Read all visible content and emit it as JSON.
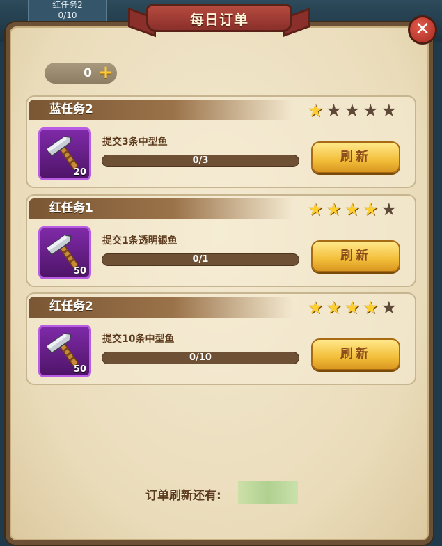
{
  "background_tab": {
    "title": "红任务2",
    "progress": "0/10"
  },
  "header": {
    "title": "每日订单"
  },
  "currency": {
    "value": "0",
    "plus_label": "+"
  },
  "tasks": [
    {
      "name": "蓝任务2",
      "stars": 1,
      "max_stars": 5,
      "item_count": "20",
      "description": "提交3条中型鱼",
      "progress_text": "0/3",
      "progress_fraction": 0,
      "button_label": "刷新"
    },
    {
      "name": "红任务1",
      "stars": 4,
      "max_stars": 5,
      "item_count": "50",
      "description": "提交1条透明银鱼",
      "progress_text": "0/1",
      "progress_fraction": 0,
      "button_label": "刷新"
    },
    {
      "name": "红任务2",
      "stars": 4,
      "max_stars": 5,
      "item_count": "50",
      "description": "提交10条中型鱼",
      "progress_text": "0/10",
      "progress_fraction": 0,
      "button_label": "刷新"
    }
  ],
  "footer": {
    "label": "订单刷新还有:"
  },
  "icons": {
    "close": "close-icon",
    "item": "hammer-icon",
    "star": "star-icon",
    "add": "plus-icon"
  },
  "colors": {
    "panel_bg": "#eadcba",
    "banner": "#b54a3f",
    "star_on": "#ffcf2e",
    "button": "#f3be3a",
    "item_bg": "#7f2aa8"
  }
}
